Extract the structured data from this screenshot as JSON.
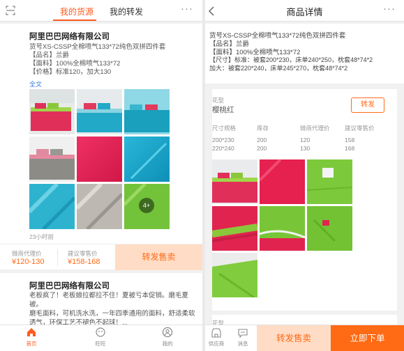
{
  "left": {
    "tabs": [
      "我的货源",
      "我的转发"
    ],
    "more": "···",
    "card1": {
      "company": "阿里巴巴网络有限公司",
      "lines": [
        "货号XS-CSSP全棉喷气133*72纯色双拼四件套",
        "【品名】兰爵",
        "【面料】100%全棉喷气133*72",
        "【价格】标准120，加大130"
      ],
      "full_text": "全文",
      "plus_count": "4+",
      "time": "23小时前"
    },
    "price_bar": {
      "agent_label": "微商代理价",
      "agent_value": "¥120-130",
      "retail_label": "建议零售价",
      "retail_value": "¥158-168",
      "forward_button": "转发售卖"
    },
    "card2": {
      "company": "阿里巴巴网络有限公司",
      "lines": [
        "老板疯了！老板娘拉都拉不住！夏被亏本促销。磨毛夏被。",
        "磨毛面料，可机洗水洗，一年四季通用的面料，舒适柔软透气，环保工艺不褪色不起球！..."
      ]
    },
    "nav": [
      "首页",
      "旺旺",
      "我的"
    ]
  },
  "right": {
    "title": "商品详情",
    "more": "···",
    "info_lines": [
      "货号XS-CSSP全棉喷气133*72纯色双拼四件套",
      "【品名】兰爵",
      "【面料】100%全棉喷气133*72",
      "【尺寸】标准：被套200*230，床单240*250，枕套48*74*2",
      "加大：被套220*240，床单245*270，枕套48*74*2"
    ],
    "sku": {
      "flower_label": "花型",
      "flower_value": "樱桃红",
      "forward_button": "转发",
      "headers": [
        "尺寸规格",
        "库存",
        "微商代理价",
        "建议零售价"
      ],
      "rows": [
        [
          "200*230",
          "200",
          "120",
          "158"
        ],
        [
          "220*240",
          "200",
          "130",
          "168"
        ]
      ]
    },
    "sku2": {
      "flower_label": "花型"
    },
    "nav": {
      "supplier": "供应商",
      "message": "消息",
      "forward_button": "转发售卖",
      "buy_button": "立即下单"
    }
  }
}
